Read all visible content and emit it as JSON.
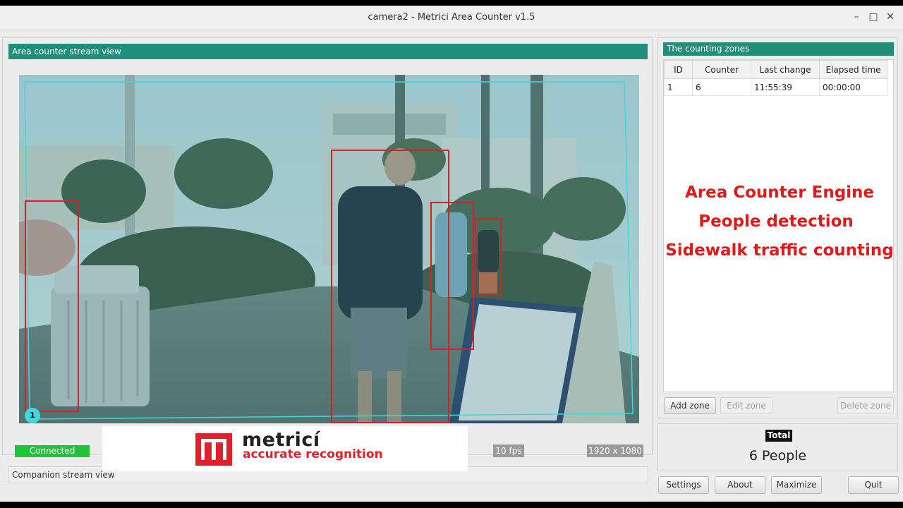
{
  "window": {
    "title": "camera2 - Metrici Area Counter v1.5"
  },
  "left": {
    "stream_header": "Area counter stream view",
    "zone_marker": "1",
    "status": {
      "connected": "Connected",
      "fps": "10 fps",
      "resolution": "1920 x 1080"
    },
    "companion_header": "Companion stream view"
  },
  "right": {
    "zones_header": "The counting zones",
    "table": {
      "headers": [
        "ID",
        "Counter",
        "Last change",
        "Elapsed time"
      ],
      "rows": [
        [
          "1",
          "6",
          "11:55:39",
          "00:00:00"
        ]
      ]
    },
    "buttons": {
      "add": "Add zone",
      "edit": "Edit zone",
      "delete": "Delete zone"
    },
    "total_label": "Total",
    "total_value": "6 People"
  },
  "bottom_buttons": {
    "settings": "Settings",
    "about": "About",
    "maximize": "Maximize",
    "quit": "Quit"
  },
  "overlay": {
    "line1": "Area Counter Engine",
    "line2": "People detection",
    "line3": "Sidewalk traffic counting"
  },
  "logo": {
    "brand": "metricí",
    "tagline": "accurate recognition"
  },
  "colors": {
    "accent": "#1f8f79",
    "detection": "#d81f26",
    "zone": "#40d8e0",
    "connected": "#22c23a"
  }
}
